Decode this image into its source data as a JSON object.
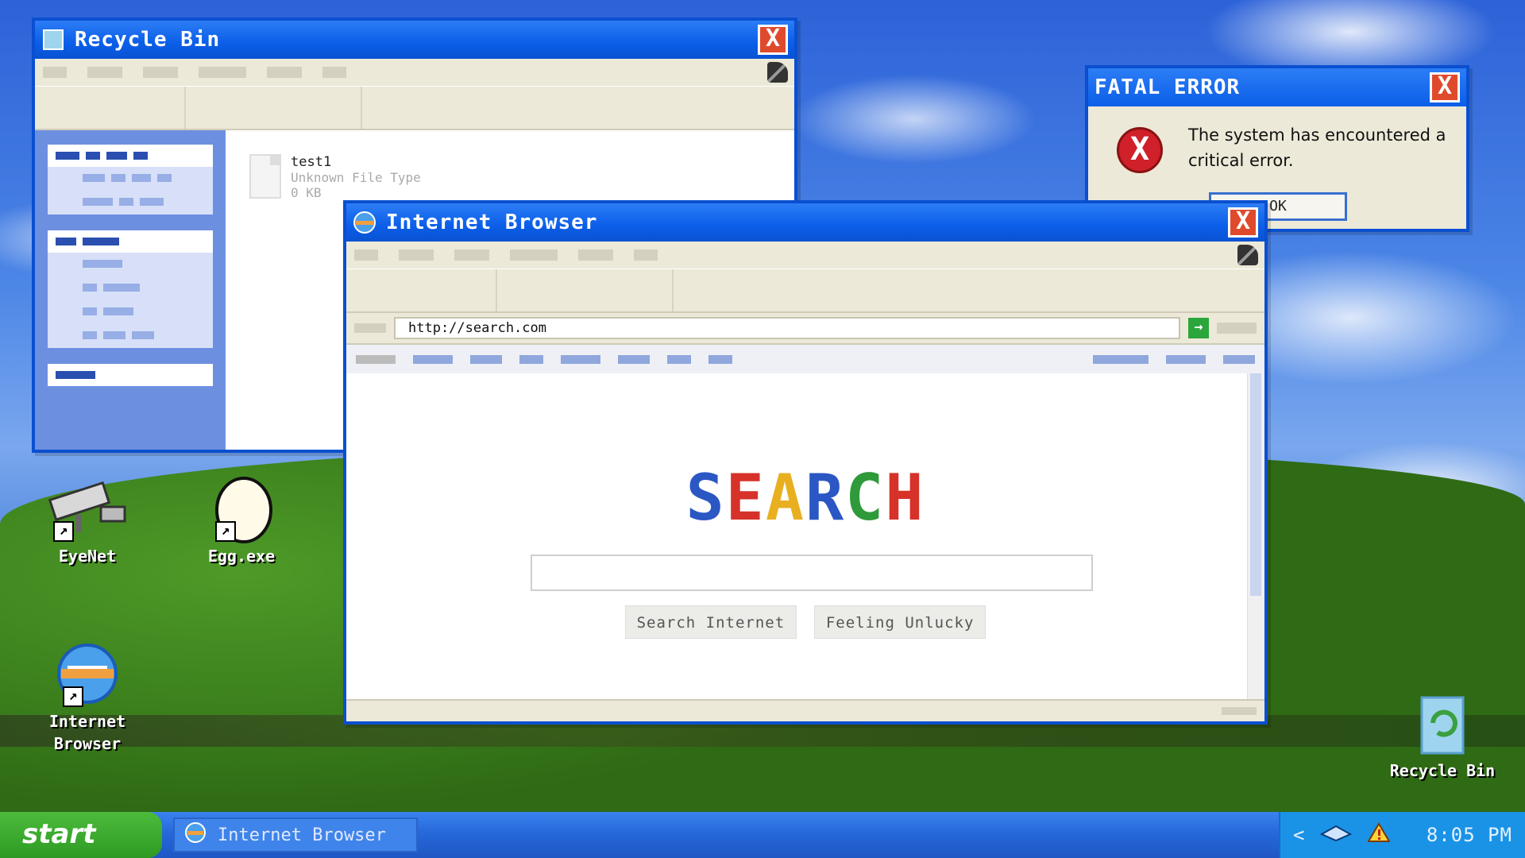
{
  "desktop": {
    "icons": [
      {
        "label": "EyeNet"
      },
      {
        "label": "Egg.exe"
      },
      {
        "label": "Internet Browser"
      },
      {
        "label": "Recycle Bin"
      }
    ]
  },
  "recycle_window": {
    "title": "Recycle Bin",
    "close_label": "X",
    "file": {
      "name": "test1",
      "type": "Unknown File Type",
      "size": "0 KB"
    }
  },
  "error_window": {
    "title": "FATAL ERROR",
    "close_label": "X",
    "message": "The system has encountered a critical error.",
    "ok_label": "OK",
    "icon_glyph": "X"
  },
  "browser_window": {
    "title": "Internet Browser",
    "close_label": "X",
    "url": "http://search.com",
    "go_label": "→",
    "logo_letters": [
      {
        "ch": "S",
        "color": "#2b57c4"
      },
      {
        "ch": "E",
        "color": "#d6322a"
      },
      {
        "ch": "A",
        "color": "#e8b021"
      },
      {
        "ch": "R",
        "color": "#2b57c4"
      },
      {
        "ch": "C",
        "color": "#2f9a3a"
      },
      {
        "ch": "H",
        "color": "#d6322a"
      }
    ],
    "search_value": "",
    "buttons": {
      "search": "Search Internet",
      "lucky": "Feeling Unlucky"
    }
  },
  "taskbar": {
    "start_label": "start",
    "task_button": "Internet Browser",
    "tray_chevron": "<",
    "clock": "8:05 PM"
  }
}
